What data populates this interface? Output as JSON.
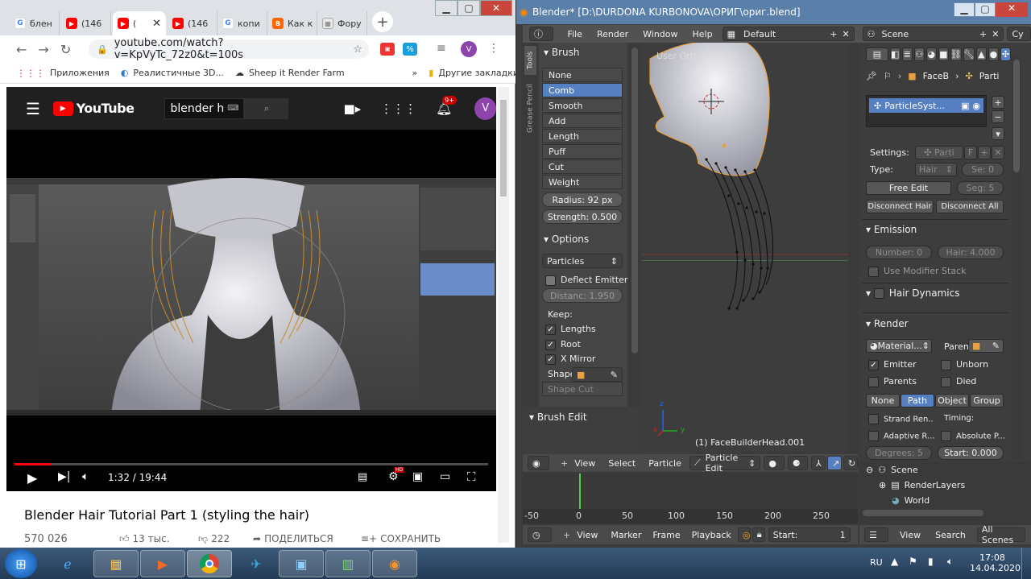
{
  "chrome": {
    "tabs": [
      {
        "label": "блен",
        "favicon": "G",
        "kind": "g"
      },
      {
        "label": "(146",
        "favicon": "▶",
        "kind": "yt"
      },
      {
        "label": "(",
        "favicon": "▶",
        "kind": "yt"
      },
      {
        "label": "(146",
        "favicon": "▶",
        "kind": "yt"
      },
      {
        "label": "копи",
        "favicon": "G",
        "kind": "g"
      },
      {
        "label": "Как к",
        "favicon": "B",
        "kind": "b"
      },
      {
        "label": "Фору",
        "favicon": "▦",
        "kind": "f"
      }
    ],
    "url": "youtube.com/watch?v=KpVyTc_72z0&t=100s",
    "avatar_letter": "V",
    "bookmarks": {
      "apps": "Приложения",
      "b1": "Реалистичные 3D...",
      "b2": "Sheep it Render Farm",
      "more": "»",
      "other": "Другие закладки"
    },
    "youtube": {
      "logo": "YouTube",
      "search_value": "blender h",
      "notif_count": "9+",
      "avatar": "V",
      "time": "1:32 / 19:44",
      "progress": 0.078,
      "title": "Blender Hair Tutorial Part 1 (styling the hair)",
      "views": "570 026",
      "likes": "13 тыс.",
      "dislikes": "222",
      "share": "ПОДЕЛИТЬСЯ",
      "save": "СОХРАНИТЬ",
      "hd": "HD"
    }
  },
  "blender": {
    "title": "Blender* [D:\\DURDONA KURBONOVA\\ОРИГ\\ориг.blend]",
    "menu": {
      "file": "File",
      "render": "Render",
      "window": "Window",
      "help": "Help"
    },
    "layout": "Default",
    "scene": "Scene",
    "scene_cut": "Cy",
    "vtabs": {
      "tools": "Tools",
      "grease": "Grease Pencil"
    },
    "tool": {
      "brush_title": "Brush",
      "brushes": [
        "None",
        "Comb",
        "Smooth",
        "Add",
        "Length",
        "Puff",
        "Cut",
        "Weight"
      ],
      "selected_brush": 1,
      "radius": "Radius:   92 px",
      "strength": "Strength: 0.500",
      "options_title": "Options",
      "mode": "Particles",
      "deflect": "Deflect Emitter",
      "distance": "Distanc: 1.950",
      "keep": "Keep:",
      "lengths": "Lengths",
      "root": "Root",
      "xmirror": "X Mirror",
      "shape": "Shape",
      "shape_cut": "Shape Cut",
      "brush_edit": "Brush Edit"
    },
    "viewport": {
      "label": "User Ortho (Local)",
      "object": "(1) FaceBuilderHead.001",
      "axis_x": "x",
      "axis_y": "y",
      "axis_z": "z"
    },
    "vp_header": {
      "view": "View",
      "select": "Select",
      "particle": "Particle",
      "mode": "Particle Edit"
    },
    "timeline": {
      "ticks": [
        "-50",
        "0",
        "50",
        "100",
        "150",
        "200",
        "250"
      ],
      "view": "View",
      "marker": "Marker",
      "frame": "Frame",
      "playback": "Playback",
      "start": "Start:",
      "start_val": "1"
    },
    "props": {
      "breadcrumb1": "FaceB",
      "breadcrumb2": "Parti",
      "psys": "ParticleSyst...",
      "settings": "Settings:",
      "settings_val": "Parti",
      "settings_f": "F",
      "type": "Type:",
      "type_val": "Hair",
      "seed": "Se: 0",
      "free_edit": "Free Edit",
      "seg": "Seg: 5",
      "disconnect": "Disconnect Hair",
      "disconnect_all": "Disconnect All",
      "emission": "Emission",
      "number": "Number: 0",
      "hair": "Hair: 4.000",
      "use_mod": "Use Modifier Stack",
      "dynamics": "Hair Dynamics",
      "render": "Render",
      "material": "Material...",
      "parent": "Parent",
      "emitter": "Emitter",
      "unborn": "Unborn",
      "parents": "Parents",
      "died": "Died",
      "tabs": [
        "None",
        "Path",
        "Object",
        "Group"
      ],
      "selected_tab": 1,
      "strand": "Strand Ren..",
      "timing": "Timing:",
      "adaptive": "Adaptive R...",
      "absolute": "Absolute P...",
      "degrees": "Degrees: 5",
      "start": "Start: 0.000"
    },
    "outliner": {
      "scene": "Scene",
      "renderlayers": "RenderLayers",
      "world": "World",
      "view": "View",
      "search": "Search",
      "filter": "All Scenes"
    }
  },
  "taskbar": {
    "lang": "RU",
    "time": "17:08",
    "date": "14.04.2020"
  }
}
